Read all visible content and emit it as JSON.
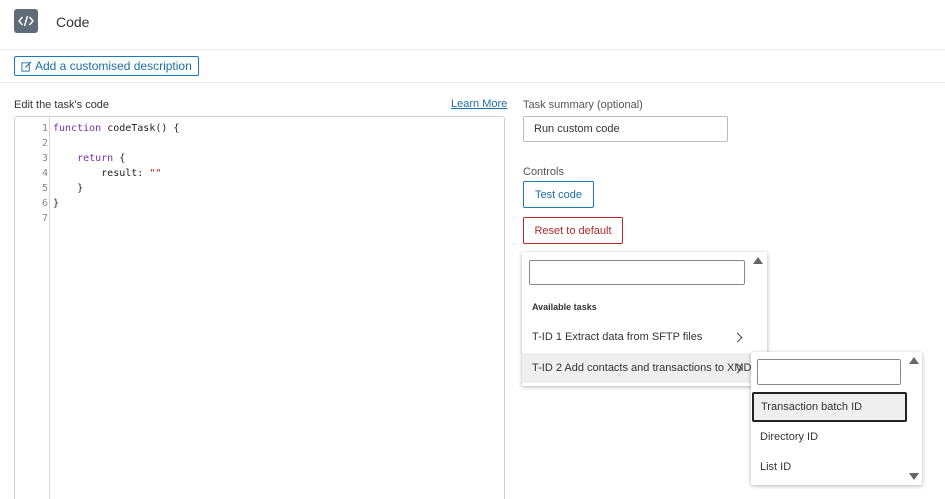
{
  "header": {
    "title": "Code",
    "icon": "code-icon"
  },
  "description_button": {
    "label": "Add a customised description",
    "icon": "edit-icon"
  },
  "editor": {
    "label": "Edit the task's code",
    "learn_more": "Learn More",
    "lines": [
      {
        "num": "1",
        "parts": [
          {
            "t": "function ",
            "c": "kw"
          },
          {
            "t": "codeTask() {",
            "c": ""
          }
        ]
      },
      {
        "num": "2",
        "parts": []
      },
      {
        "num": "3",
        "parts": [
          {
            "t": "    return",
            "c": "kw"
          },
          {
            "t": " {",
            "c": ""
          }
        ]
      },
      {
        "num": "4",
        "parts": [
          {
            "t": "        result: ",
            "c": ""
          },
          {
            "t": "\"\"",
            "c": "str"
          }
        ]
      },
      {
        "num": "5",
        "parts": [
          {
            "t": "    }",
            "c": ""
          }
        ]
      },
      {
        "num": "6",
        "parts": [
          {
            "t": "}",
            "c": ""
          }
        ]
      },
      {
        "num": "7",
        "parts": []
      }
    ]
  },
  "summary": {
    "label": "Task summary (optional)",
    "value": "Run custom code"
  },
  "controls": {
    "label": "Controls",
    "test_label": "Test code",
    "reset_label": "Reset to default"
  },
  "tasks_menu": {
    "search_value": "",
    "group_label": "Available tasks",
    "items": [
      {
        "label": "T-ID 1 Extract data from SFTP files"
      },
      {
        "label": "T-ID 2 Add contacts and transactions to XMD"
      }
    ]
  },
  "fields_menu": {
    "search_value": "",
    "options": [
      {
        "label": "Transaction batch ID"
      },
      {
        "label": "Directory ID"
      },
      {
        "label": "List ID"
      }
    ]
  },
  "colors": {
    "accent": "#1a6fa8",
    "danger": "#b02a2a",
    "icon_bg": "#5f6b77"
  }
}
